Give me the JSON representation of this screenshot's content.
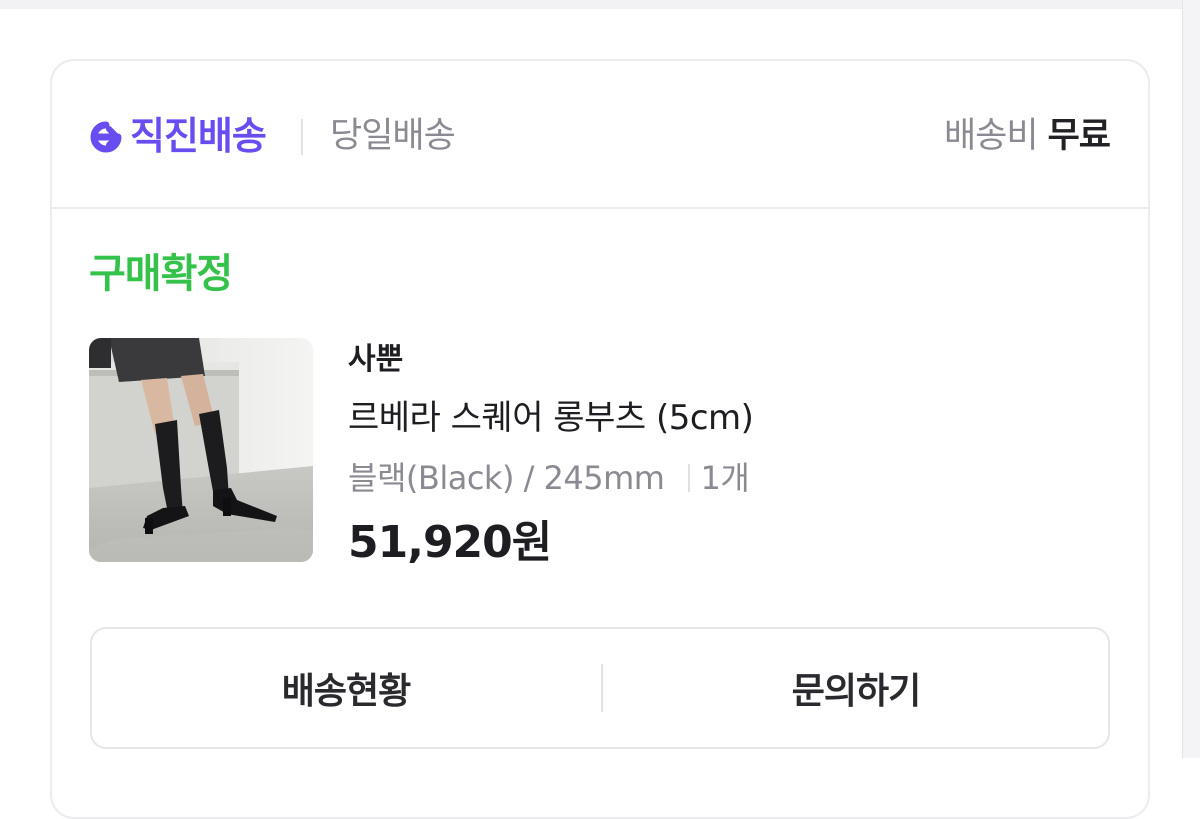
{
  "header": {
    "delivery_brand": "직진배송",
    "delivery_type": "당일배송",
    "shipping_fee_label": "배송비",
    "shipping_fee_value": "무료",
    "brand_color": "#6a4df0"
  },
  "order": {
    "status": "구매확정",
    "status_color": "#35c24a"
  },
  "product": {
    "brand": "사뿐",
    "name": "르베라 스퀘어 롱부츠 (5cm)",
    "option": "블랙(Black) / 245mm",
    "quantity": "1개",
    "price": "51,920원",
    "image": "boots-photo"
  },
  "actions": {
    "track_label": "배송현황",
    "inquiry_label": "문의하기"
  }
}
